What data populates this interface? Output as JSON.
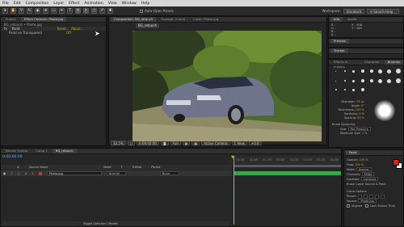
{
  "menu": [
    "File",
    "Edit",
    "Composition",
    "Layer",
    "Effect",
    "Animation",
    "View",
    "Window",
    "Help"
  ],
  "toolbar": {
    "auto_open": "Auto-Open Panels",
    "workspace_label": "Workspace:",
    "workspace_value": "Standard",
    "search": "Search Help"
  },
  "left_panel": {
    "tabs": [
      "Project",
      "Effect Controls: Photo.jpg"
    ],
    "header": "BG_retouch • Photo.jpg",
    "effect_name": "Paint",
    "reset": "Reset",
    "about": "About...",
    "option": "Paint on Transparent",
    "option_value": "Off"
  },
  "viewer": {
    "tabs": [
      "Composition: BG_retouch",
      "Footage: (none)",
      "Layer: Photo.jpg"
    ],
    "comp_tab": "BG_retouch",
    "zoom": "32.5%",
    "timecode": "0:00:00:00",
    "resolution": "Full",
    "camera": "Active Camera",
    "views": "1 View",
    "exposure": "+0.0"
  },
  "info_panel": {
    "tabs": [
      "Info",
      "Audio"
    ],
    "r": "R :",
    "g": "G :",
    "b": "B :",
    "a": "A :",
    "x": "X : 408",
    "y": "Y : 188"
  },
  "preview": {
    "tab": "Preview"
  },
  "tracker": {
    "tab": "Tracker"
  },
  "brushes": {
    "tabs": [
      "Effects & Presets",
      "Character",
      "Brushes"
    ],
    "diameter_label": "Diameter:",
    "diameter": "15 px",
    "angle_label": "Angle:",
    "angle": "0°",
    "roundness_label": "Roundness:",
    "roundness": "100 %",
    "hardness_label": "Hardness:",
    "hardness": "0 %",
    "spacing_label": "Spacing:",
    "spacing": "25 %",
    "dynamics_label": "Brush Dynamics",
    "size_label": "Size:",
    "size": "Pen Pressure",
    "min_size_label": "Minimum Size:",
    "min_size": "1 %"
  },
  "paint": {
    "tab": "Paint",
    "opacity_label": "Opacity:",
    "opacity": "100 %",
    "flow_label": "Flow:",
    "flow": "100 %",
    "mode_label": "Mode:",
    "mode": "Normal",
    "channels_label": "Channels:",
    "channels": "RGBA",
    "duration_label": "Duration:",
    "duration": "Constant",
    "erase_label": "Erase:",
    "erase": "Layer Source & Paint",
    "clone_label": "Clone Options",
    "preset_label": "Preset:",
    "source_label": "Source:",
    "source": "Photo.jpg",
    "aligned": "Aligned",
    "lock_source": "Lock Source Time",
    "fg_color": "#e61b1b",
    "bg_color": "#ffffff"
  },
  "timeline": {
    "tabs": [
      "Render Queue",
      "Comp 1",
      "BG_retouch"
    ],
    "timecode": "0:00:00:00",
    "columns": [
      "#",
      "Source Name",
      "Mode",
      "T",
      "TrkMat",
      "Parent"
    ],
    "layer_num": "1",
    "layer_name": "Photo.jpg",
    "layer_mode": "Normal",
    "layer_parent": "None",
    "ruler": [
      "00:15f",
      "01:00f",
      "01:15f",
      "02:00f",
      "02:15f",
      "03:00f",
      "03:15f",
      "04:00f"
    ],
    "toggle": "Toggle Switches / Modes"
  },
  "colors": {
    "accent": "#e61b1b",
    "layer_bar": "#3aa64a",
    "playhead": "#e0a020"
  }
}
